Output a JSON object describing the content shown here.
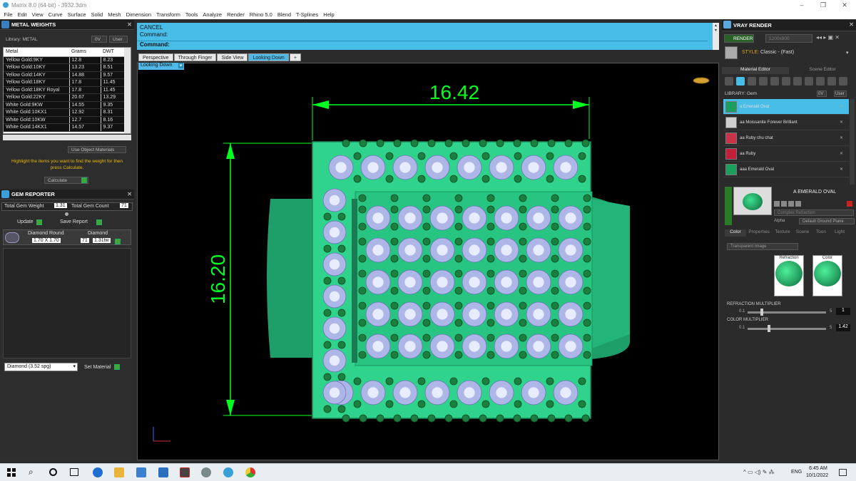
{
  "window": {
    "title": "Matrix 8.0 (64-bit) - 3932.3dm"
  },
  "menu": [
    "File",
    "Edit",
    "View",
    "Curve",
    "Surface",
    "Solid",
    "Mesh",
    "Dimension",
    "Transform",
    "Tools",
    "Analyze",
    "Render",
    "Rhino 5.0",
    "Blend",
    "T-Splines",
    "Help"
  ],
  "metal_weights": {
    "title": "METAL WEIGHTS",
    "library_label": "Library: METAL",
    "filter_labels": [
      "0V",
      "User"
    ],
    "columns": [
      "Metal",
      "Grams",
      "DWT"
    ],
    "rows": [
      [
        "Yellow Gold:9KY",
        "12.8",
        "8.23"
      ],
      [
        "Yellow Gold:10KY",
        "13.23",
        "8.51"
      ],
      [
        "Yellow Gold:14KY",
        "14.88",
        "9.57"
      ],
      [
        "Yellow Gold:18KY",
        "17.8",
        "11.45"
      ],
      [
        "Yellow Gold:18KY Royal",
        "17.8",
        "11.45"
      ],
      [
        "Yellow Gold:22KY",
        "20.67",
        "13.29"
      ],
      [
        "White Gold:9KW",
        "14.55",
        "9.35"
      ],
      [
        "White Gold:10KX1",
        "12.92",
        "8.31"
      ],
      [
        "White Gold:10KW",
        "12.7",
        "8.16"
      ],
      [
        "White Gold:14KX1",
        "14.57",
        "9.37"
      ]
    ],
    "use_object_materials": "Use Object Materials",
    "hint": "Highlight the items you want to find the weight for then press Calculate.",
    "calculate": "Calculate"
  },
  "gem_reporter": {
    "title": "GEM REPORTER",
    "total_weight_label": "Total Gem Weight",
    "total_weight": "1.31",
    "total_count_label": "Total Gem Count",
    "total_count": "71",
    "update": "Update",
    "save_report": "Save Report",
    "gem_row": {
      "shape": "Diamond Round",
      "size": "1.70 X 1.70",
      "type": "Diamond",
      "count": "71",
      "tw": "1.31tw"
    },
    "material_select": "Diamond    (3.52 spg)",
    "set_material": "Set Material"
  },
  "command": {
    "line1": "CANCEL",
    "line2": "Command:",
    "prompt": "Command:"
  },
  "viewport_tabs": [
    "Perspective",
    "Through Finger",
    "Side View",
    "Looking Down"
  ],
  "active_view": "Looking Down",
  "dimensions": {
    "width": "16.42",
    "height": "16.20"
  },
  "vray": {
    "title": "VRAY RENDER",
    "render_label": "RENDER",
    "resolution": "1200x900",
    "style_label": "STYLE:",
    "style_value": "Classic - (Fast)",
    "tabs": [
      "Material Editor",
      "Scene Editor"
    ],
    "library_label": "LIBRARY: Gem",
    "library_items": [
      {
        "name": "a Emerald Oval",
        "color": "#1e9e5e"
      },
      {
        "name": "aa Moissanite Forever Brilliant",
        "color": "#cfcfcf"
      },
      {
        "name": "aa Ruby chu chat",
        "color": "#c8324a"
      },
      {
        "name": "aa Ruby",
        "color": "#c21f3a"
      },
      {
        "name": "aaa Emerald Oval",
        "color": "#1e9e5e"
      }
    ],
    "preview_name": "A EMERALD OVAL",
    "complex_refraction": "Complex Refraction",
    "alpha_label": "Alpha",
    "ground": "Default Ground Plane",
    "sub_tabs": [
      "Color",
      "Properties",
      "Texture",
      "Scene",
      "Toon",
      "Light"
    ],
    "transparent": "Transparent Image",
    "swatch_labels": [
      "Refraction",
      "Color"
    ],
    "refraction_mult_label": "REFRACTION MULTIPLIER",
    "refraction_min": "0.1",
    "refraction_max": "5",
    "refraction_value": "1",
    "color_mult_label": "COLOR MULTIPLIER",
    "color_min": "0.1",
    "color_max": "5",
    "color_value": "1.42"
  },
  "taskbar": {
    "lang": "ENG",
    "time": "6:45 AM",
    "date": "10/1/2022"
  },
  "colors": {
    "accent": "#47bde8",
    "dim": "#00ff1e",
    "metal": "#2fd38c"
  }
}
